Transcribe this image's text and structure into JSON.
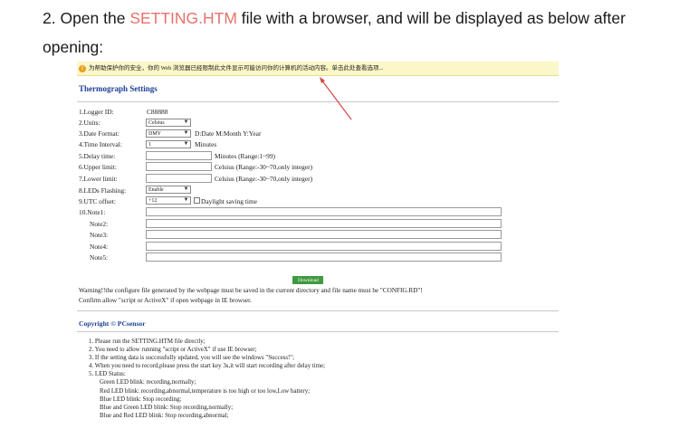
{
  "heading": {
    "prefix": "2. Open the ",
    "highlight": "SETTING.HTM",
    "suffix_line1": " file with a browser, and will be displayed as below after",
    "line2": "opening:"
  },
  "colors": {
    "highlight": "#e8716b",
    "title_blue": "#1b3f95",
    "infobar_bg": "#fbf7c8",
    "arrow": "#d64545",
    "download_green": "#3f9a3f"
  },
  "screenshot": {
    "infobar": {
      "icon": "warning-shield-icon",
      "text": "为帮助保护你的安全，你的 Web 浏览器已经限制此文件显示可能访问你的计算机的活动内容。单击此处查看选项..."
    },
    "title": "Thermograph Settings",
    "fields": {
      "logger_id": {
        "label": "1.Logger ID:",
        "value": "C88888"
      },
      "units": {
        "label": "2.Units:",
        "selected": "Celsius"
      },
      "date_format": {
        "label": "3.Date Format:",
        "selected": "DMY",
        "hint": "D:Date M:Month Y:Year"
      },
      "time_interval": {
        "label": "4.Time Interval:",
        "selected": "1",
        "hint": "Minutes"
      },
      "delay_time": {
        "label": "5.Delay time:",
        "value": "",
        "hint": "Minutes (Range:1~99)"
      },
      "upper_limit": {
        "label": "6.Upper limit:",
        "value": "",
        "hint": "Celsius (Range:-30~70,only integer)"
      },
      "lower_limit": {
        "label": "7.Lower limit:",
        "value": "",
        "hint": "Celsius (Range:-30~70,only integer)"
      },
      "leds_flashing": {
        "label": "8.LEDs Flashing:",
        "selected": "Enable"
      },
      "utc_offset": {
        "label": "9.UTC offset:",
        "selected": "+12",
        "checkbox_label": "Daylight saving time",
        "checked": false
      },
      "notes": [
        {
          "label": "10.Note1:",
          "value": ""
        },
        {
          "label": "Note2:",
          "value": ""
        },
        {
          "label": "Note3:",
          "value": ""
        },
        {
          "label": "Note4:",
          "value": ""
        },
        {
          "label": "Note5:",
          "value": ""
        }
      ]
    },
    "download_label": "Download",
    "warning_line1": "Warning!!the configure file generated by the webpage must be saved in the current directory and file name must be \"CONFIG.RD\"!",
    "warning_line2": "Confirm allow \"script or ActiveX\" if open webpage in IE browser.",
    "copyright": "Copyright © PCsensor",
    "steps": [
      "1. Please run the SETTING.HTM file directly;",
      "2. You need to allow running \"script or ActiveX\" if use IE browser;",
      "3. If the setting data is successfully updated, you will see the windows \"Success!\";",
      "4. When you need to record,please press the start key 3s,it will start recording after delay time;",
      "5. LED Status:"
    ],
    "led_status": [
      "Green LED blink: recording,normally;",
      "Red LED blink: recording,abnormal,temperature is too high or too low,Low battery;",
      "Blue LED blink: Stop recording;",
      "Blue and Green LED blink: Stop recording,normally;",
      "Blue and Red LED blink: Stop recording,abnormal;"
    ]
  }
}
